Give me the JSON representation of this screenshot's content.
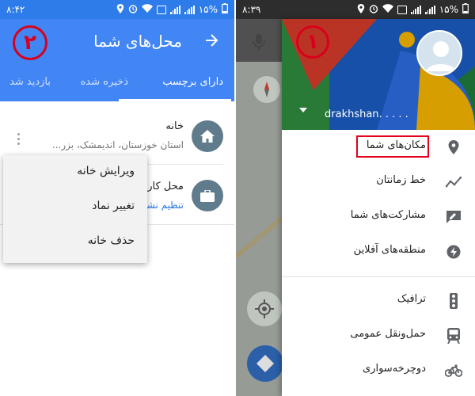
{
  "left_screen": {
    "status_bar": {
      "time": "۸:۴۲",
      "battery": "۱۵%"
    },
    "app_bar": {
      "title": "محل‌های شما",
      "step_number": "۲"
    },
    "tabs": [
      {
        "label": "دارای برچسب",
        "active": true
      },
      {
        "label": "ذخیره شده",
        "active": false
      },
      {
        "label": "بازدید شد",
        "active": false
      }
    ],
    "places": [
      {
        "name": "خانه",
        "address": "استان خوزستان، اندیمشک، بزر..."
      },
      {
        "name": "محل کار",
        "action": "تنظیم نشانی"
      }
    ],
    "popup_menu": [
      "ویرایش خانه",
      "تغییر نماد",
      "حذف خانه"
    ]
  },
  "right_screen": {
    "status_bar": {
      "time": "۸:۳۹",
      "battery": "۱۵%"
    },
    "drawer": {
      "step_number": "۱",
      "account_name": "drakhshan. . . . .",
      "menu": [
        {
          "label": "مکان‌های شما",
          "icon": "location-pin-icon",
          "highlighted": true
        },
        {
          "label": "خط زمانتان",
          "icon": "timeline-icon"
        },
        {
          "label": "مشارکت‌های شما",
          "icon": "contribute-icon"
        },
        {
          "label": "منطقه‌های آفلاین",
          "icon": "offline-bolt-icon"
        },
        {
          "label": "ترافیک",
          "icon": "traffic-light-icon"
        },
        {
          "label": "حمل‌ونقل عمومی",
          "icon": "transit-icon"
        },
        {
          "label": "دوچرخه‌سواری",
          "icon": "bicycle-icon"
        }
      ]
    },
    "colors": {
      "highlight_border": "#e3001b",
      "app_bar_blue": "#4285f4"
    }
  }
}
